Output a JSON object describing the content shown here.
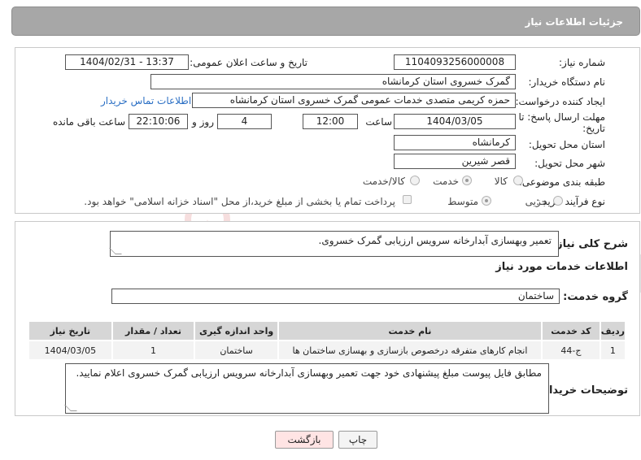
{
  "header": {
    "title": "جزئیات اطلاعات نیاز"
  },
  "form": {
    "need_number_label": "شماره نیاز:",
    "need_number": "1104093256000008",
    "announce_label": "تاریخ و ساعت اعلان عمومی:",
    "announce_value": "1404/02/31 - 13:37",
    "buyer_org_label": "نام دستگاه خریدار:",
    "buyer_org": "گمرک خسروی استان کرمانشاه",
    "creator_label": "ایجاد کننده درخواست:",
    "creator": "حمزه کریمی متصدی خدمات عمومی گمرک خسروی استان کرمانشاه",
    "contact_link": "اطلاعات تماس خریدار",
    "deadline_label_line1": "مهلت ارسال پاسخ: تا",
    "deadline_label_line2": "تاریخ:",
    "deadline_date": "1404/03/05",
    "time_label": "ساعت",
    "deadline_time": "12:00",
    "days_value": "4",
    "days_label": "روز و",
    "remaining_time": "22:10:06",
    "remaining_label": "ساعت باقی مانده",
    "province_label": "استان محل تحویل:",
    "province": "کرمانشاه",
    "city_label": "شهر محل تحویل:",
    "city": "قصر شیرین",
    "category_label": "طبقه بندی موضوعی:",
    "category_options": [
      "کالا",
      "خدمت",
      "کالا/خدمت"
    ],
    "process_label": "نوع فرآیند خرید :",
    "process_options": [
      "جزیی",
      "متوسط"
    ],
    "payment_note": "پرداخت تمام یا بخشی از مبلغ خرید،از محل \"اسناد خزانه اسلامی\" خواهد بود."
  },
  "details": {
    "summary_label": "شرح کلی نیاز:",
    "summary": "تعمیر وبهسازی آبدارخانه سرویس ارزیابی گمرک خسروی.",
    "services_title": "اطلاعات خدمات مورد نیاز",
    "service_group_label": "گروه خدمت:",
    "service_group": "ساختمان",
    "table": {
      "headers": [
        "ردیف",
        "کد خدمت",
        "نام خدمت",
        "واحد اندازه گیری",
        "تعداد / مقدار",
        "تاریخ نیاز"
      ],
      "rows": [
        [
          "1",
          "ج-44",
          "انجام کارهای متفرقه درخصوص بازسازی و بهسازی ساختمان ها",
          "ساختمان",
          "1",
          "1404/03/05"
        ]
      ]
    },
    "buyer_notes_label": "توضیحات خریدار:",
    "buyer_notes": "مطابق فایل پیوست مبلغ پیشنهادی خود جهت تعمیر وبهسازی آبدارخانه سرویس ارزیابی گمرک خسروی اعلام نمایید."
  },
  "buttons": {
    "print": "چاپ",
    "back": "بازگشت"
  },
  "colors": {
    "header_bg": "#a7a7a7",
    "link": "#2b6fc4",
    "back_button_bg": "#ffe4e4"
  }
}
